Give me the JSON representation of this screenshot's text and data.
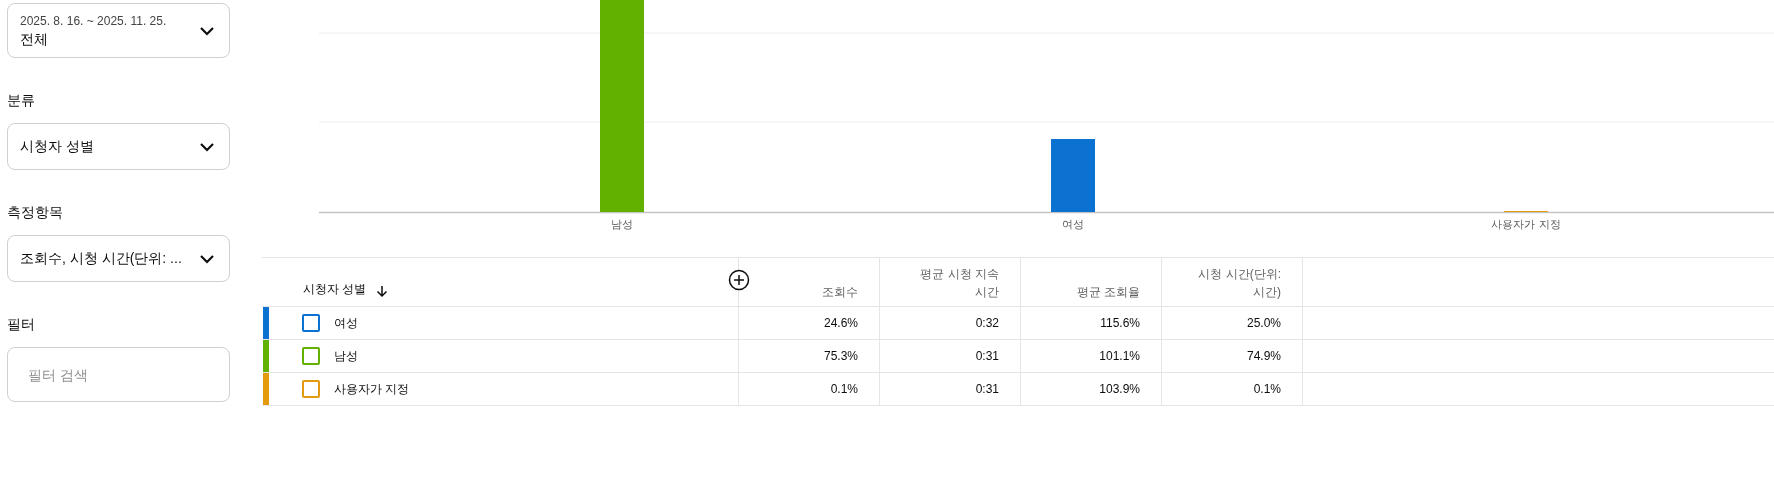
{
  "sidebar": {
    "date_range": {
      "range": "2025. 8. 16. ~ 2025. 11. 25.",
      "value": "전체"
    },
    "sections": [
      {
        "label": "분류",
        "value": "시청자 성별"
      },
      {
        "label": "측정항목",
        "value": "조회수, 시청 시간(단위: ..."
      }
    ],
    "filter": {
      "label": "필터",
      "placeholder": "필터 검색"
    }
  },
  "chart": {
    "labels": [
      "남성",
      "여성",
      "사용자가 지정"
    ]
  },
  "table": {
    "columns": [
      {
        "label": "시청자 성별",
        "sorted_descending": true
      },
      {
        "label": "조회수"
      },
      {
        "label": "평균 시청 지속 시간"
      },
      {
        "label": "평균 조회율"
      },
      {
        "label": "시청 시간(단위: 시간)"
      }
    ],
    "rows": [
      {
        "color": "#0b72d2",
        "checked": false,
        "cells": [
          "여성",
          "24.6%",
          "0:32",
          "115.6%",
          "25.0%"
        ]
      },
      {
        "color": "#62b000",
        "checked": false,
        "cells": [
          "남성",
          "75.3%",
          "0:31",
          "101.1%",
          "74.9%"
        ]
      },
      {
        "color": "#e49a0e",
        "checked": false,
        "cells": [
          "사용자가 지정",
          "0.1%",
          "0:31",
          "103.9%",
          "0.1%"
        ]
      }
    ]
  }
}
